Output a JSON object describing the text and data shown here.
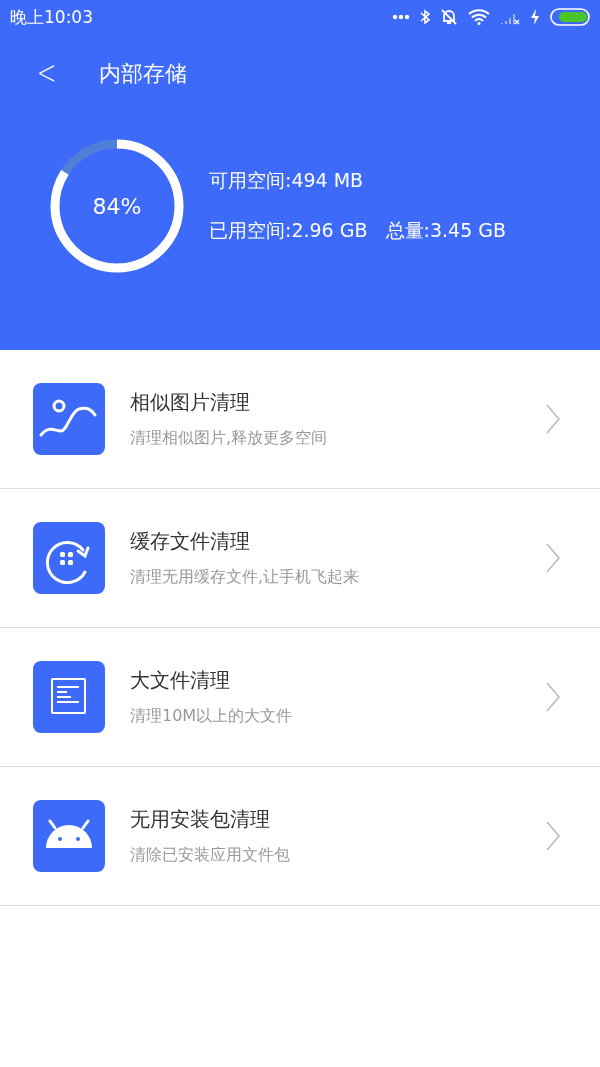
{
  "status_bar": {
    "time": "晚上10:03"
  },
  "header": {
    "back": "<",
    "title": "内部存储"
  },
  "storage": {
    "level": 0.84,
    "percent": "84%",
    "free": "可用空间:494 MB",
    "used": "已用空间:2.96 GB",
    "total": "总量:3.45 GB"
  },
  "items": [
    {
      "kind": "photo",
      "title": "相似图片清理",
      "subtitle": "清理相似图片,释放更多空间"
    },
    {
      "kind": "cache",
      "title": "缓存文件清理",
      "subtitle": "清理无用缓存文件,让手机飞起来"
    },
    {
      "kind": "document",
      "title": "大文件清理",
      "subtitle": "清理10M以上的大文件"
    },
    {
      "kind": "android",
      "title": "无用安装包清理",
      "subtitle": "清除已安装应用文件包"
    }
  ]
}
